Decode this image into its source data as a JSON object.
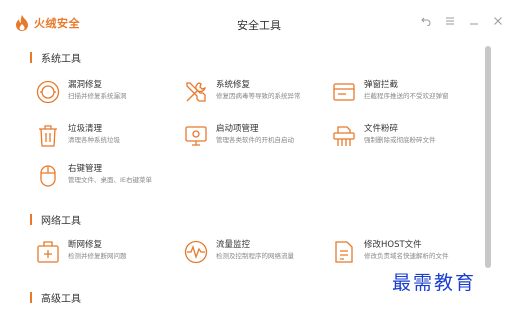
{
  "app": {
    "name": "火绒安全",
    "window_title": "安全工具"
  },
  "colors": {
    "accent": "#e8792b",
    "watermark": "#1a3fd0"
  },
  "window_controls": [
    {
      "icon": "back-icon"
    },
    {
      "icon": "menu-icon"
    },
    {
      "icon": "minimize-icon"
    },
    {
      "icon": "close-icon"
    }
  ],
  "sections": [
    {
      "title": "系统工具"
    },
    {
      "title": "网络工具"
    },
    {
      "title": "高级工具"
    }
  ],
  "tools": {
    "vuln_fix": {
      "name": "漏洞修复",
      "desc": "扫描并修复系统漏洞",
      "icon": "vulnerability-icon"
    },
    "sys_repair": {
      "name": "系统修复",
      "desc": "修复因病毒等导致的系统异常",
      "icon": "wrench-screwdriver-icon"
    },
    "popup_block": {
      "name": "弹窗拦截",
      "desc": "拦截程序推送的不受欢迎弹窗",
      "icon": "popup-window-icon"
    },
    "junk_clean": {
      "name": "垃圾清理",
      "desc": "清理各种系统垃圾",
      "icon": "trash-icon"
    },
    "startup_mgr": {
      "name": "启动项管理",
      "desc": "管理各类软件的开机自启动",
      "icon": "monitor-icon"
    },
    "file_shred": {
      "name": "文件粉碎",
      "desc": "强制删除或彻底粉碎文件",
      "icon": "shredder-icon"
    },
    "context_menu": {
      "name": "右键管理",
      "desc": "管理文件、桌面、IE右键菜单",
      "icon": "mouse-icon"
    },
    "net_repair": {
      "name": "断网修复",
      "desc": "检测并修复断网问题",
      "icon": "network-repair-icon"
    },
    "traffic_mon": {
      "name": "流量监控",
      "desc": "检测及控制程序的网络流量",
      "icon": "traffic-icon"
    },
    "hosts_edit": {
      "name": "修改HOST文件",
      "desc": "修改负责域名快速解析的文件",
      "icon": "document-edit-icon"
    }
  },
  "watermark": "最需教育"
}
